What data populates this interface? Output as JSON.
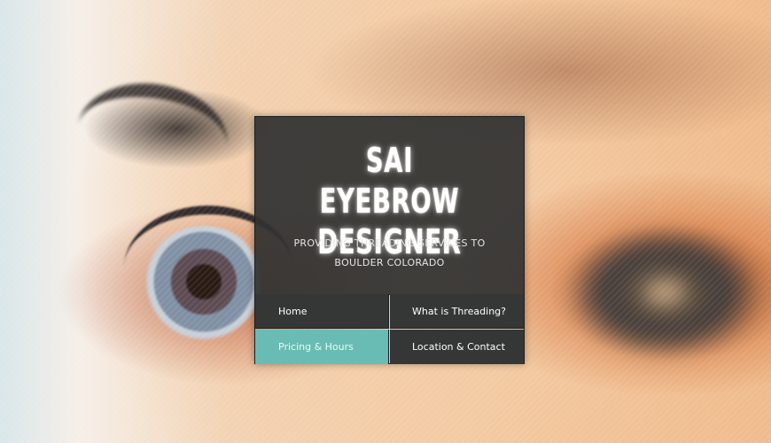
{
  "site": {
    "title_line1": "SAI EYEBROW",
    "title_line2": "DESIGNER",
    "tagline": "PROVIDING THREADING SERVICES TO BOULDER COLORADO"
  },
  "nav": {
    "items": [
      {
        "label": "Home",
        "active": false
      },
      {
        "label": "What is Threading?",
        "active": false
      },
      {
        "label": "Pricing & Hours",
        "active": true
      },
      {
        "label": "Location & Contact",
        "active": false
      }
    ]
  },
  "colors": {
    "panel_bg": "#303232",
    "nav_bg": "#353737",
    "active_bg": "#69bcb3",
    "text": "#ffffff"
  },
  "background": {
    "icon": "eye-closeup-photo"
  }
}
